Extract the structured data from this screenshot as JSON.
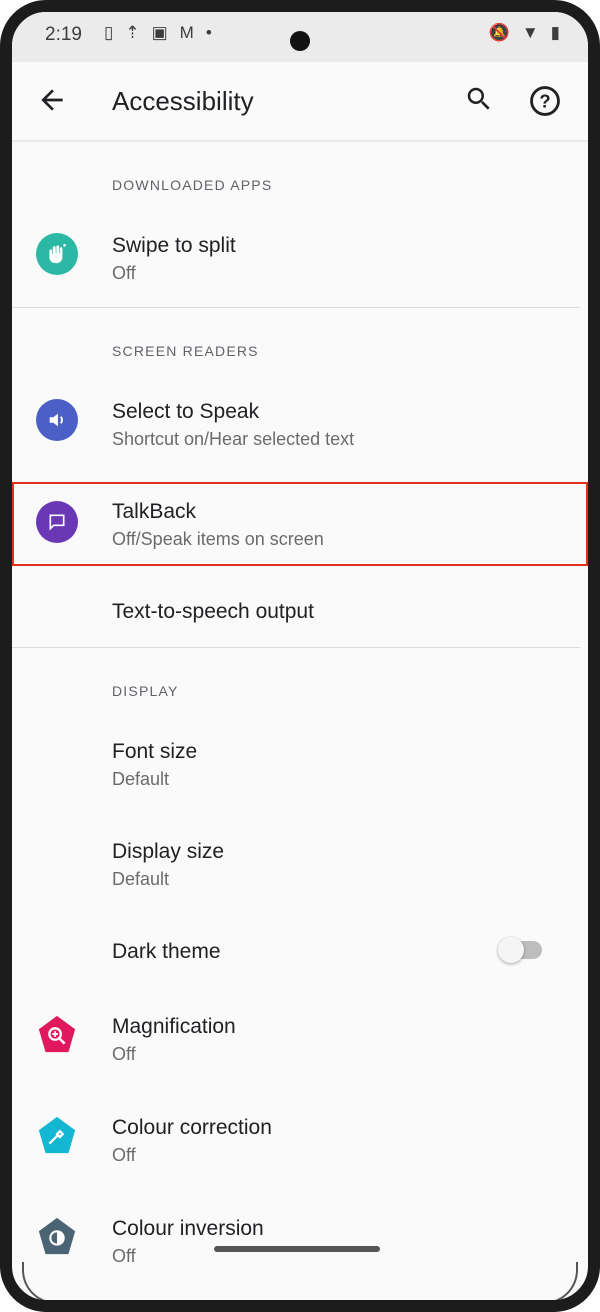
{
  "status_bar": {
    "time": "2:19",
    "left_icons": [
      "sim-icon",
      "upload-icon",
      "no-sim-icon",
      "gmail-icon",
      "dot-icon"
    ],
    "right_icons": [
      "mute-icon",
      "wifi-icon",
      "battery-icon"
    ]
  },
  "app_bar": {
    "title": "Accessibility"
  },
  "sections": {
    "downloaded_apps": "DOWNLOADED APPS",
    "screen_readers": "SCREEN READERS",
    "display": "DISPLAY"
  },
  "items": {
    "swipe_to_split": {
      "title": "Swipe to split",
      "subtitle": "Off"
    },
    "select_to_speak": {
      "title": "Select to Speak",
      "subtitle": "Shortcut on/Hear selected text"
    },
    "talkback": {
      "title": "TalkBack",
      "subtitle": "Off/Speak items on screen"
    },
    "tts_output": {
      "title": "Text-to-speech output"
    },
    "font_size": {
      "title": "Font size",
      "subtitle": "Default"
    },
    "display_size": {
      "title": "Display size",
      "subtitle": "Default"
    },
    "dark_theme": {
      "title": "Dark theme",
      "toggle_on": false
    },
    "magnification": {
      "title": "Magnification",
      "subtitle": "Off"
    },
    "colour_correction": {
      "title": "Colour correction",
      "subtitle": "Off"
    },
    "colour_inversion": {
      "title": "Colour inversion",
      "subtitle": "Off"
    }
  },
  "colors": {
    "highlight_border": "#e0331c",
    "swipe_icon_bg": "#2bb9a6",
    "select_to_speak_bg": "#4b5fc6",
    "talkback_bg": "#6a38b5",
    "magnification_bg": "#e2185e",
    "colour_correction_bg": "#13b7d1",
    "colour_inversion_bg": "#4b6474"
  }
}
